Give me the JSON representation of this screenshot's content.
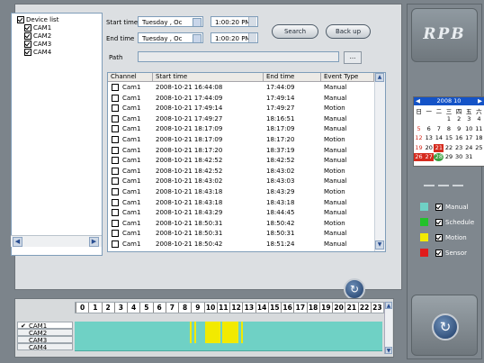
{
  "tree": {
    "root_label": "Device list",
    "cams": [
      "CAM1",
      "CAM2",
      "CAM3",
      "CAM4"
    ]
  },
  "search": {
    "start_label": "Start time",
    "end_label": "End time",
    "start_date": "Tuesday , Oc",
    "end_date": "Tuesday , Oc",
    "start_time": "1:00:20 PM",
    "end_time": "1:00:20 PM",
    "path_label": "Path",
    "path_value": "",
    "browse_label": "...",
    "search_button": "Search",
    "backup_button": "Back up"
  },
  "table": {
    "columns": [
      "Channel",
      "Start time",
      "End time",
      "Event Type"
    ],
    "rows": [
      {
        "channel": "Cam1",
        "start": "2008-10-21 16:44:08",
        "end": "17:44:09",
        "type": "Manual"
      },
      {
        "channel": "Cam1",
        "start": "2008-10-21 17:44:09",
        "end": "17:49:14",
        "type": "Manual"
      },
      {
        "channel": "Cam1",
        "start": "2008-10-21 17:49:14",
        "end": "17:49:27",
        "type": "Motion"
      },
      {
        "channel": "Cam1",
        "start": "2008-10-21 17:49:27",
        "end": "18:16:51",
        "type": "Manual"
      },
      {
        "channel": "Cam1",
        "start": "2008-10-21 18:17:09",
        "end": "18:17:09",
        "type": "Manual"
      },
      {
        "channel": "Cam1",
        "start": "2008-10-21 18:17:09",
        "end": "18:17:20",
        "type": "Motion"
      },
      {
        "channel": "Cam1",
        "start": "2008-10-21 18:17:20",
        "end": "18:37:19",
        "type": "Manual"
      },
      {
        "channel": "Cam1",
        "start": "2008-10-21 18:42:52",
        "end": "18:42:52",
        "type": "Manual"
      },
      {
        "channel": "Cam1",
        "start": "2008-10-21 18:42:52",
        "end": "18:43:02",
        "type": "Motion"
      },
      {
        "channel": "Cam1",
        "start": "2008-10-21 18:43:02",
        "end": "18:43:03",
        "type": "Manual"
      },
      {
        "channel": "Cam1",
        "start": "2008-10-21 18:43:18",
        "end": "18:43:29",
        "type": "Motion"
      },
      {
        "channel": "Cam1",
        "start": "2008-10-21 18:43:18",
        "end": "18:43:18",
        "type": "Manual"
      },
      {
        "channel": "Cam1",
        "start": "2008-10-21 18:43:29",
        "end": "18:44:45",
        "type": "Manual"
      },
      {
        "channel": "Cam1",
        "start": "2008-10-21 18:50:31",
        "end": "18:50:42",
        "type": "Motion"
      },
      {
        "channel": "Cam1",
        "start": "2008-10-21 18:50:31",
        "end": "18:50:31",
        "type": "Manual"
      },
      {
        "channel": "Cam1",
        "start": "2008-10-21 18:50:42",
        "end": "18:51:24",
        "type": "Manual"
      }
    ]
  },
  "timeline": {
    "hours": [
      "0",
      "1",
      "2",
      "3",
      "4",
      "5",
      "6",
      "7",
      "8",
      "9",
      "10",
      "11",
      "12",
      "13",
      "14",
      "15",
      "16",
      "17",
      "18",
      "19",
      "20",
      "21",
      "22",
      "23"
    ],
    "channels": [
      "CAM1",
      "CAM2",
      "CAM3",
      "CAM4"
    ],
    "selected_channel": "CAM1",
    "motion_segments_hours": [
      [
        9.0,
        9.1
      ],
      [
        9.3,
        9.4
      ],
      [
        10.2,
        11.4
      ],
      [
        11.5,
        12.8
      ],
      [
        13.0,
        13.1
      ]
    ]
  },
  "brand": "RPB",
  "calendar": {
    "title": "2008  10",
    "dow": [
      "日",
      "一",
      "二",
      "三",
      "四",
      "五",
      "六"
    ],
    "weeks": [
      [
        "",
        "",
        "",
        "1",
        "2",
        "3",
        "4"
      ],
      [
        "5",
        "6",
        "7",
        "8",
        "9",
        "10",
        "11"
      ],
      [
        "12",
        "13",
        "14",
        "15",
        "16",
        "17",
        "18"
      ],
      [
        "19",
        "20",
        "21",
        "22",
        "23",
        "24",
        "25"
      ],
      [
        "26",
        "27",
        "28",
        "29",
        "30",
        "31",
        ""
      ]
    ],
    "colors": {
      "header": "#1453c7",
      "red_day": "#d52b1e"
    }
  },
  "legend": [
    {
      "label": "Manual",
      "color": "#6fd1c5"
    },
    {
      "label": "Schedule",
      "color": "#23c12a"
    },
    {
      "label": "Motion",
      "color": "#f2ea00"
    },
    {
      "label": "Sensor",
      "color": "#e11b1b"
    }
  ]
}
